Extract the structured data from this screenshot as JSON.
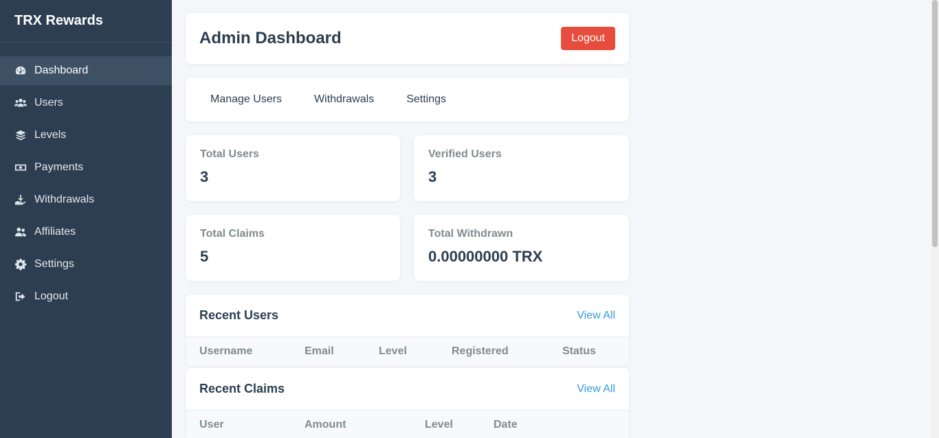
{
  "brand": "TRX Rewards",
  "sidebar": {
    "items": [
      {
        "label": "Dashboard",
        "icon": "dashboard-icon"
      },
      {
        "label": "Users",
        "icon": "users-icon"
      },
      {
        "label": "Levels",
        "icon": "layers-icon"
      },
      {
        "label": "Payments",
        "icon": "money-icon"
      },
      {
        "label": "Withdrawals",
        "icon": "hand-money-icon"
      },
      {
        "label": "Affiliates",
        "icon": "user-friends-icon"
      },
      {
        "label": "Settings",
        "icon": "gear-icon"
      },
      {
        "label": "Logout",
        "icon": "sign-out-icon"
      }
    ],
    "active": "Dashboard"
  },
  "header": {
    "title": "Admin Dashboard",
    "logout_label": "Logout"
  },
  "tabs": [
    "Manage Users",
    "Withdrawals",
    "Settings"
  ],
  "stats": [
    {
      "label": "Total Users",
      "value": "3"
    },
    {
      "label": "Verified Users",
      "value": "3"
    },
    {
      "label": "Total Claims",
      "value": "5"
    },
    {
      "label": "Total Withdrawn",
      "value": "0.00000000 TRX"
    }
  ],
  "recent_users": {
    "title": "Recent Users",
    "view_all": "View All",
    "columns": [
      "Username",
      "Email",
      "Level",
      "Registered",
      "Status"
    ]
  },
  "recent_claims": {
    "title": "Recent Claims",
    "view_all": "View All",
    "columns": [
      "User",
      "Amount",
      "Level",
      "Date"
    ]
  },
  "colors": {
    "sidebar": "#2c3e50",
    "accent": "#3498db",
    "danger": "#e74c3c"
  }
}
